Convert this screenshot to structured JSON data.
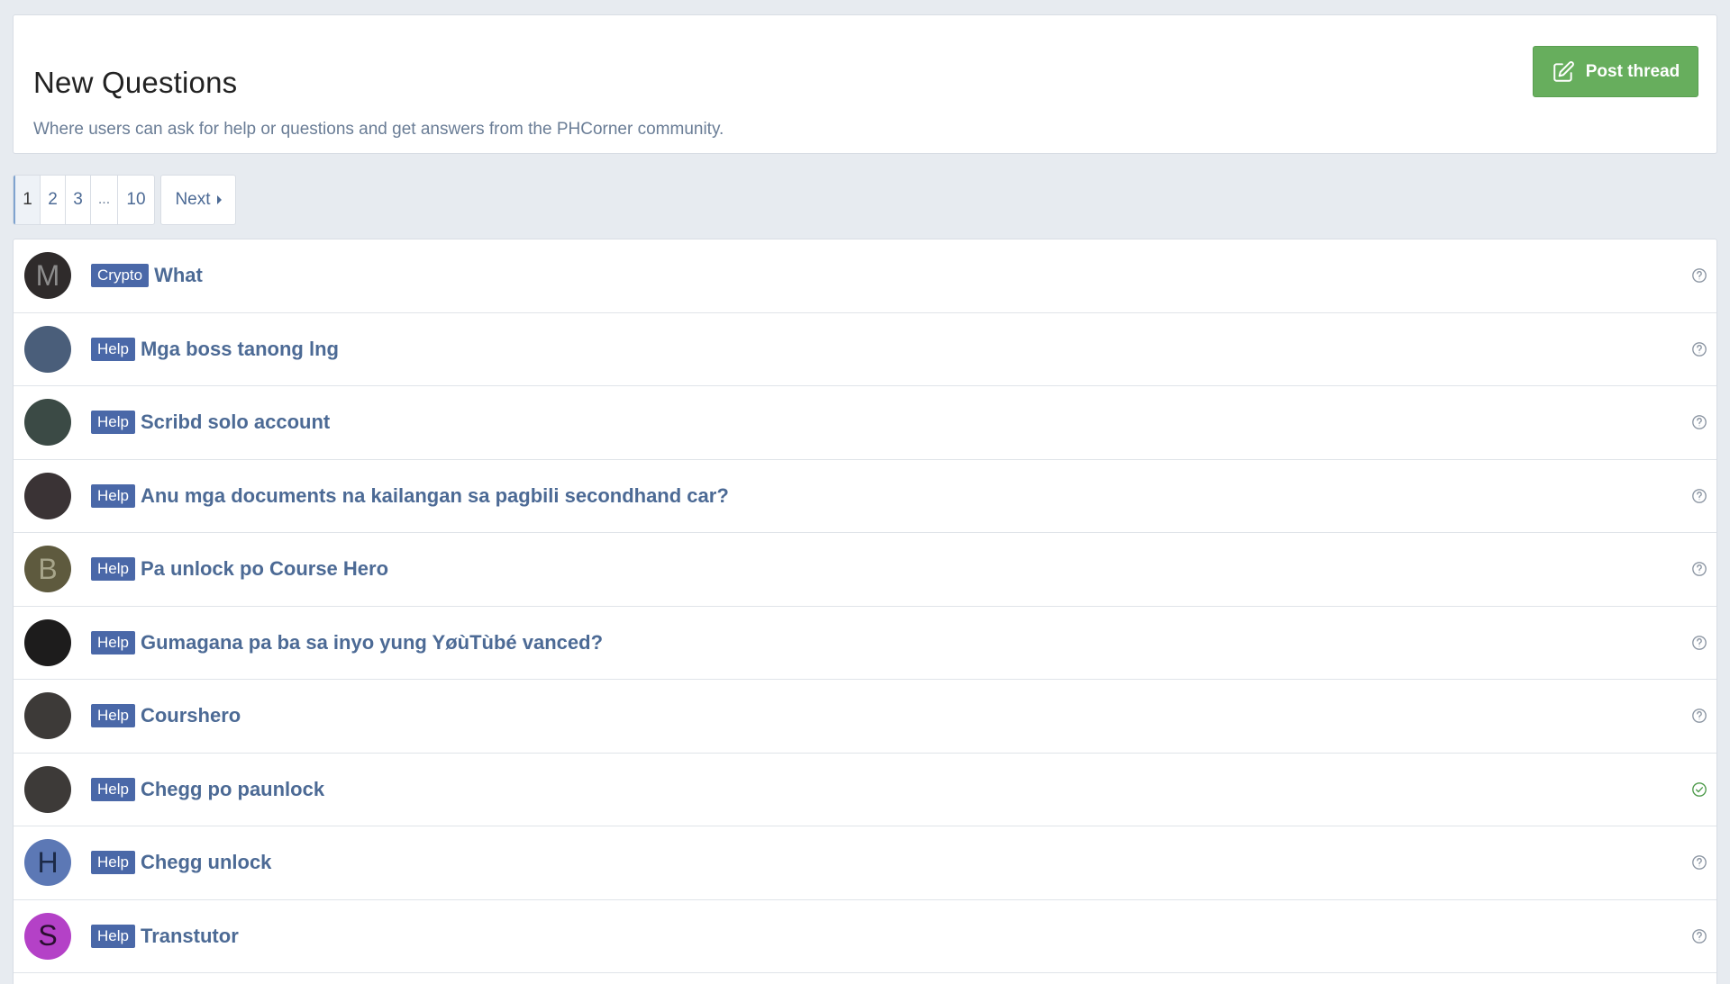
{
  "header": {
    "title": "New Questions",
    "description": "Where users can ask for help or questions and get answers from the PHCorner community.",
    "post_button_label": "Post thread"
  },
  "pagination": {
    "pages": [
      "1",
      "2",
      "3",
      "...",
      "10"
    ],
    "current": "1",
    "next_label": "Next"
  },
  "threads": [
    {
      "avatar_letter": "M",
      "avatar_color": "#2f2b2b",
      "avatar_text_color": "#8c8c8c",
      "prefix": "Crypto",
      "title": "What",
      "status": "question"
    },
    {
      "avatar_letter": "",
      "avatar_color": "#4a5e7a",
      "avatar_text_color": "#ffffff",
      "prefix": "Help",
      "title": "Mga boss tanong lng",
      "status": "question"
    },
    {
      "avatar_letter": "",
      "avatar_color": "#3b4a45",
      "avatar_text_color": "#ffffff",
      "prefix": "Help",
      "title": "Scribd solo account",
      "status": "question"
    },
    {
      "avatar_letter": "",
      "avatar_color": "#3a3335",
      "avatar_text_color": "#ffffff",
      "prefix": "Help",
      "title": "Anu mga documents na kailangan sa pagbili secondhand car?",
      "status": "question"
    },
    {
      "avatar_letter": "B",
      "avatar_color": "#5e5a3e",
      "avatar_text_color": "#a7a58a",
      "prefix": "Help",
      "title": "Pa unlock po Course Hero",
      "status": "question"
    },
    {
      "avatar_letter": "",
      "avatar_color": "#1d1c1c",
      "avatar_text_color": "#ffffff",
      "prefix": "Help",
      "title": "Gumagana pa ba sa inyo yung YøùTùbé vanced?",
      "status": "question"
    },
    {
      "avatar_letter": "",
      "avatar_color": "#3d3a38",
      "avatar_text_color": "#ffffff",
      "prefix": "Help",
      "title": "Courshero",
      "status": "question"
    },
    {
      "avatar_letter": "",
      "avatar_color": "#3d3a38",
      "avatar_text_color": "#ffffff",
      "prefix": "Help",
      "title": "Chegg po paunlock",
      "status": "solved"
    },
    {
      "avatar_letter": "H",
      "avatar_color": "#5c78b5",
      "avatar_text_color": "#1c2a48",
      "prefix": "Help",
      "title": "Chegg unlock",
      "status": "question"
    },
    {
      "avatar_letter": "S",
      "avatar_color": "#b441c7",
      "avatar_text_color": "#2a0f30",
      "prefix": "Help",
      "title": "Transtutor",
      "status": "question"
    }
  ],
  "colors": {
    "accent_green": "#67ae5d",
    "link_blue": "#4c6a95",
    "label_blue": "#4a68a8",
    "solved_green": "#4d9a4a",
    "question_gray": "#8c96a3"
  }
}
